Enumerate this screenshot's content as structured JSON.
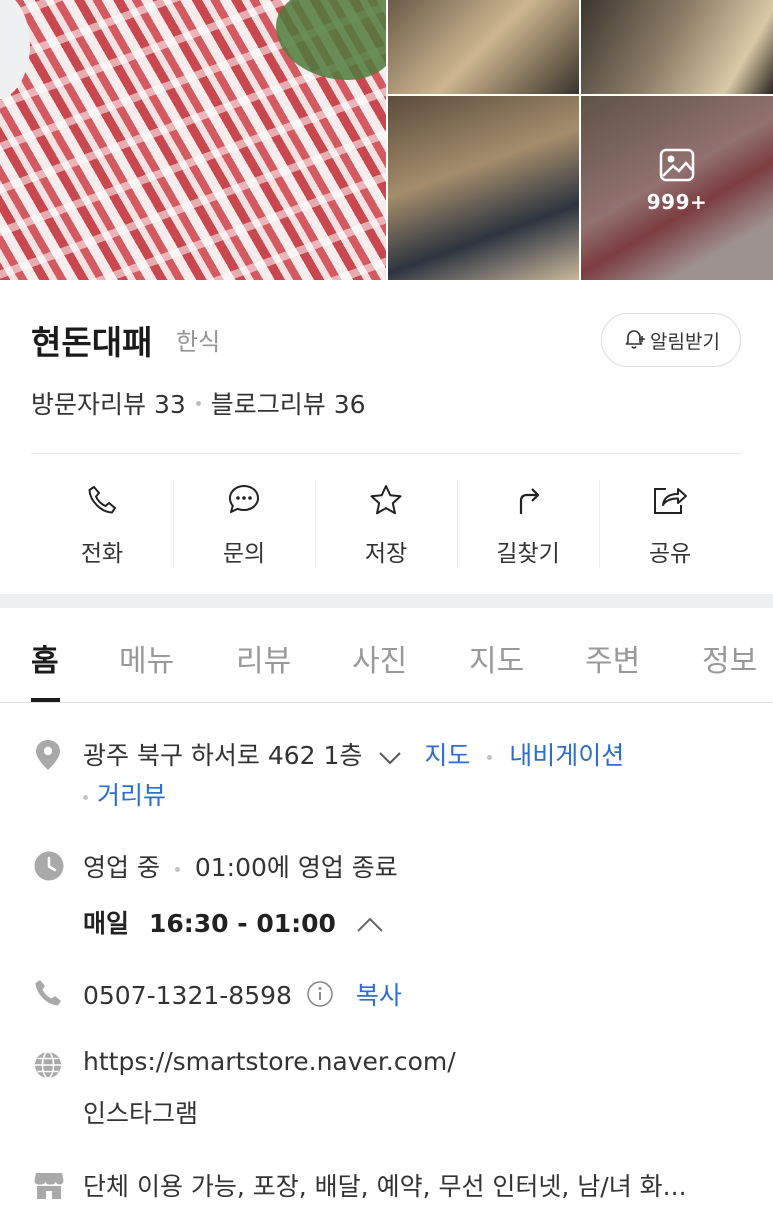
{
  "gallery": {
    "more_count": "999+",
    "more_icon": "image-icon"
  },
  "place": {
    "name": "현돈대패",
    "category": "한식"
  },
  "alarm_button": {
    "label": "알림받기",
    "icon": "bell-plus-icon"
  },
  "reviews": {
    "visitor": "방문자리뷰 33",
    "blog": "블로그리뷰 36"
  },
  "actions": [
    {
      "label": "전화",
      "icon": "phone-icon"
    },
    {
      "label": "문의",
      "icon": "chat-icon"
    },
    {
      "label": "저장",
      "icon": "star-icon"
    },
    {
      "label": "길찾기",
      "icon": "directions-icon"
    },
    {
      "label": "공유",
      "icon": "share-icon"
    }
  ],
  "tabs": [
    {
      "label": "홈",
      "active": true
    },
    {
      "label": "메뉴"
    },
    {
      "label": "리뷰"
    },
    {
      "label": "사진"
    },
    {
      "label": "지도"
    },
    {
      "label": "주변"
    },
    {
      "label": "정보"
    }
  ],
  "info": {
    "address": "광주 북구 하서로 462 1층",
    "map_link": "지도",
    "navigation_link": "내비게이션",
    "streetview_link": "거리뷰",
    "status": "영업 중",
    "status_note": "01:00에 영업 종료",
    "hours_day": "매일",
    "hours_time": "16:30 - 01:00",
    "phone": "0507-1321-8598",
    "copy_label": "복사",
    "website": "https://smartstore.naver.com/",
    "instagram": "인스타그램",
    "facilities": "단체 이용 가능, 포장, 배달, 예약, 무선 인터넷, 남/녀 화..."
  },
  "colors": {
    "link": "#2c6dd0",
    "icon_gray": "#a9a9a9"
  }
}
